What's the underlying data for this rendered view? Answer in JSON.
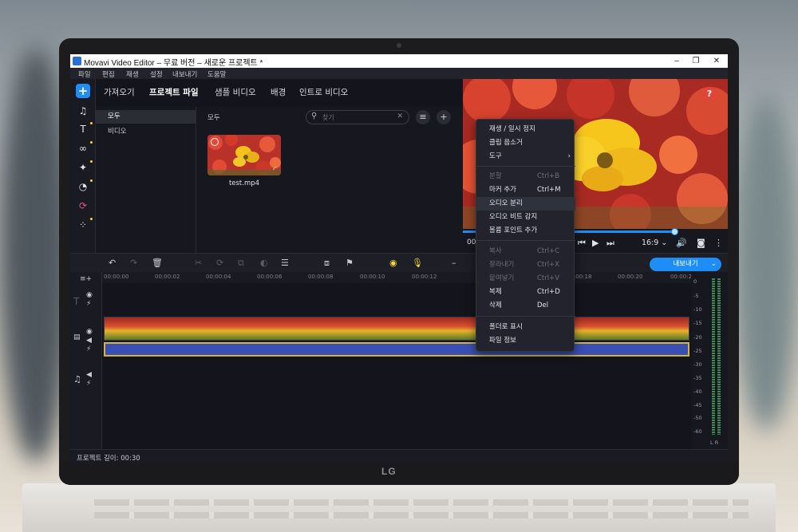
{
  "window": {
    "title": "Movavi Video Editor – 무료 버전 – 새로운 프로젝트 *",
    "minimize": "–",
    "maximize": "❐",
    "close": "✕"
  },
  "menubar": [
    "파일",
    "편집",
    "재생",
    "설정",
    "내보내기",
    "도움말"
  ],
  "tools": {
    "add": "+",
    "music": "♫",
    "titles": "T",
    "transitions": "∞",
    "effects": "✦",
    "filters": "◔",
    "stickers": "⟳",
    "more": "⁘"
  },
  "tabs": [
    "가져오기",
    "프로젝트 파일",
    "샘플 비디오",
    "배경",
    "인트로 비디오"
  ],
  "categories": [
    "모두",
    "비디오"
  ],
  "media": {
    "crumb": "모두",
    "search_icon": "⚲",
    "search_placeholder": "찾기",
    "clear_icon": "✕",
    "sort_icon": "≡",
    "add_icon": "+",
    "file_name": "test.mp4"
  },
  "preview": {
    "help_icon": "?",
    "timecode": "00",
    "aspect": "16:9 ⌄",
    "prev_icon": "⏮",
    "play_icon": "▶",
    "next_icon": "⏭",
    "volume_icon": "🔊",
    "snapshot_icon": "◙",
    "more_icon": "⋮",
    "progress_fraction": 0.8
  },
  "timeline_toolbar": {
    "undo": "↶",
    "redo": "↷",
    "delete": "🗑",
    "cut": "✂",
    "rotate": "⟳",
    "crop": "⧉",
    "color": "◐",
    "adjust": "☰",
    "stabilize": "⧈",
    "flag": "⚑",
    "webcam": "◉",
    "mic": "🎙",
    "zoom_out": "–",
    "export": "내보내기",
    "export_arrow": "⌄"
  },
  "ruler": [
    "00:00:00",
    "00:00:02",
    "00:00:04",
    "00:00:06",
    "00:00:08",
    "00:00:10",
    "00:00:12",
    "00:00:18",
    "00:00:20",
    "00:00:2"
  ],
  "track_icons": {
    "add_track": "≡+",
    "title_track": "T",
    "eye": "◉",
    "mute": "⚡",
    "video_track": "▤",
    "audio_track": "♫",
    "volume": "◀"
  },
  "meter": [
    "0",
    "-5",
    "-10",
    "-15",
    "-20",
    "-25",
    "-30",
    "-35",
    "-40",
    "-45",
    "-50",
    "-60"
  ],
  "meter_lr": "L R",
  "status": "프로젝트 길이: 00:30",
  "context_menu": [
    {
      "label": "재생 / 일시 정지",
      "shortcut": "",
      "disabled": false
    },
    {
      "label": "클립 음소거",
      "shortcut": "",
      "disabled": false
    },
    {
      "label": "도구",
      "shortcut": "",
      "disabled": false,
      "submenu": "›"
    },
    {
      "label": "분할",
      "shortcut": "Ctrl+B",
      "disabled": true
    },
    {
      "label": "마커 추가",
      "shortcut": "Ctrl+M",
      "disabled": false
    },
    {
      "label": "오디오 분리",
      "shortcut": "",
      "disabled": false,
      "hover": true
    },
    {
      "label": "오디오 비트 감지",
      "shortcut": "",
      "disabled": false
    },
    {
      "label": "볼륨 포인트 추가",
      "shortcut": "",
      "disabled": false
    },
    {
      "label": "복사",
      "shortcut": "Ctrl+C",
      "disabled": true
    },
    {
      "label": "잘라내기",
      "shortcut": "Ctrl+X",
      "disabled": true
    },
    {
      "label": "붙여넣기",
      "shortcut": "Ctrl+V",
      "disabled": true
    },
    {
      "label": "복제",
      "shortcut": "Ctrl+D",
      "disabled": false
    },
    {
      "label": "삭제",
      "shortcut": "Del",
      "disabled": false
    },
    {
      "label": "폴더로 표시",
      "shortcut": "",
      "disabled": false
    },
    {
      "label": "파일 정보",
      "shortcut": "",
      "disabled": false
    }
  ],
  "brand": "LG"
}
